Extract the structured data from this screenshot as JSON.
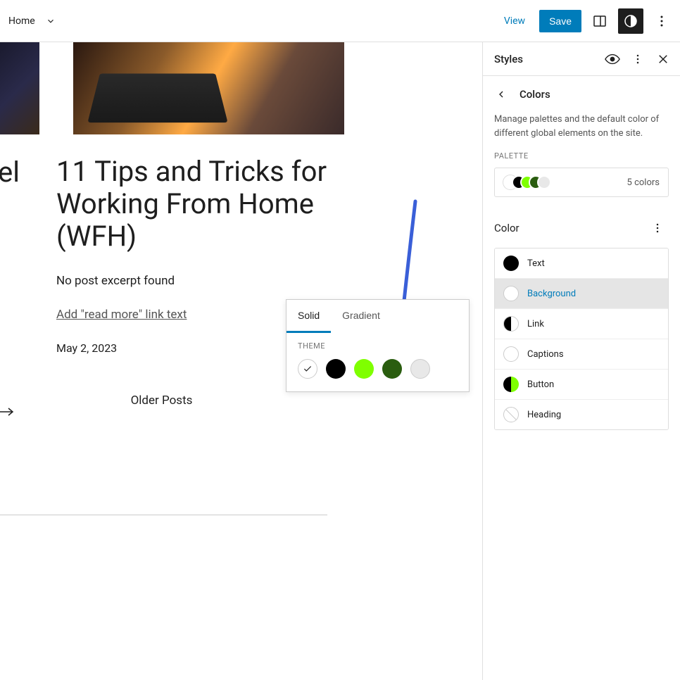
{
  "topbar": {
    "home_label": "Home",
    "view_label": "View",
    "save_label": "Save"
  },
  "post": {
    "left_title_fragment": "vel",
    "title": "11 Tips and Tricks for Working From Home (WFH)",
    "excerpt": "No post excerpt found",
    "read_more_placeholder": "Add \"read more\" link text",
    "date": "May 2, 2023",
    "older_posts": "Older Posts"
  },
  "popover": {
    "tabs": {
      "solid": "Solid",
      "gradient": "Gradient"
    },
    "theme_label": "THEME",
    "swatches": [
      {
        "color": "#ffffff",
        "selected": true
      },
      {
        "color": "#000000",
        "selected": false
      },
      {
        "color": "#7fff00",
        "selected": false
      },
      {
        "color": "#2a5d0f",
        "selected": false
      },
      {
        "color": "#e8e8e8",
        "selected": false
      }
    ]
  },
  "sidebar": {
    "title": "Styles",
    "nav_title": "Colors",
    "description": "Manage palettes and the default color of different global elements on the site.",
    "palette_label": "PALETTE",
    "palette_count": "5 colors",
    "palette_preview": [
      "#ffffff",
      "#000000",
      "#7fff00",
      "#2a5d0f",
      "#e8e8e8"
    ],
    "color_title": "Color",
    "items": [
      {
        "label": "Text"
      },
      {
        "label": "Background"
      },
      {
        "label": "Link"
      },
      {
        "label": "Captions"
      },
      {
        "label": "Button"
      },
      {
        "label": "Heading"
      }
    ]
  }
}
